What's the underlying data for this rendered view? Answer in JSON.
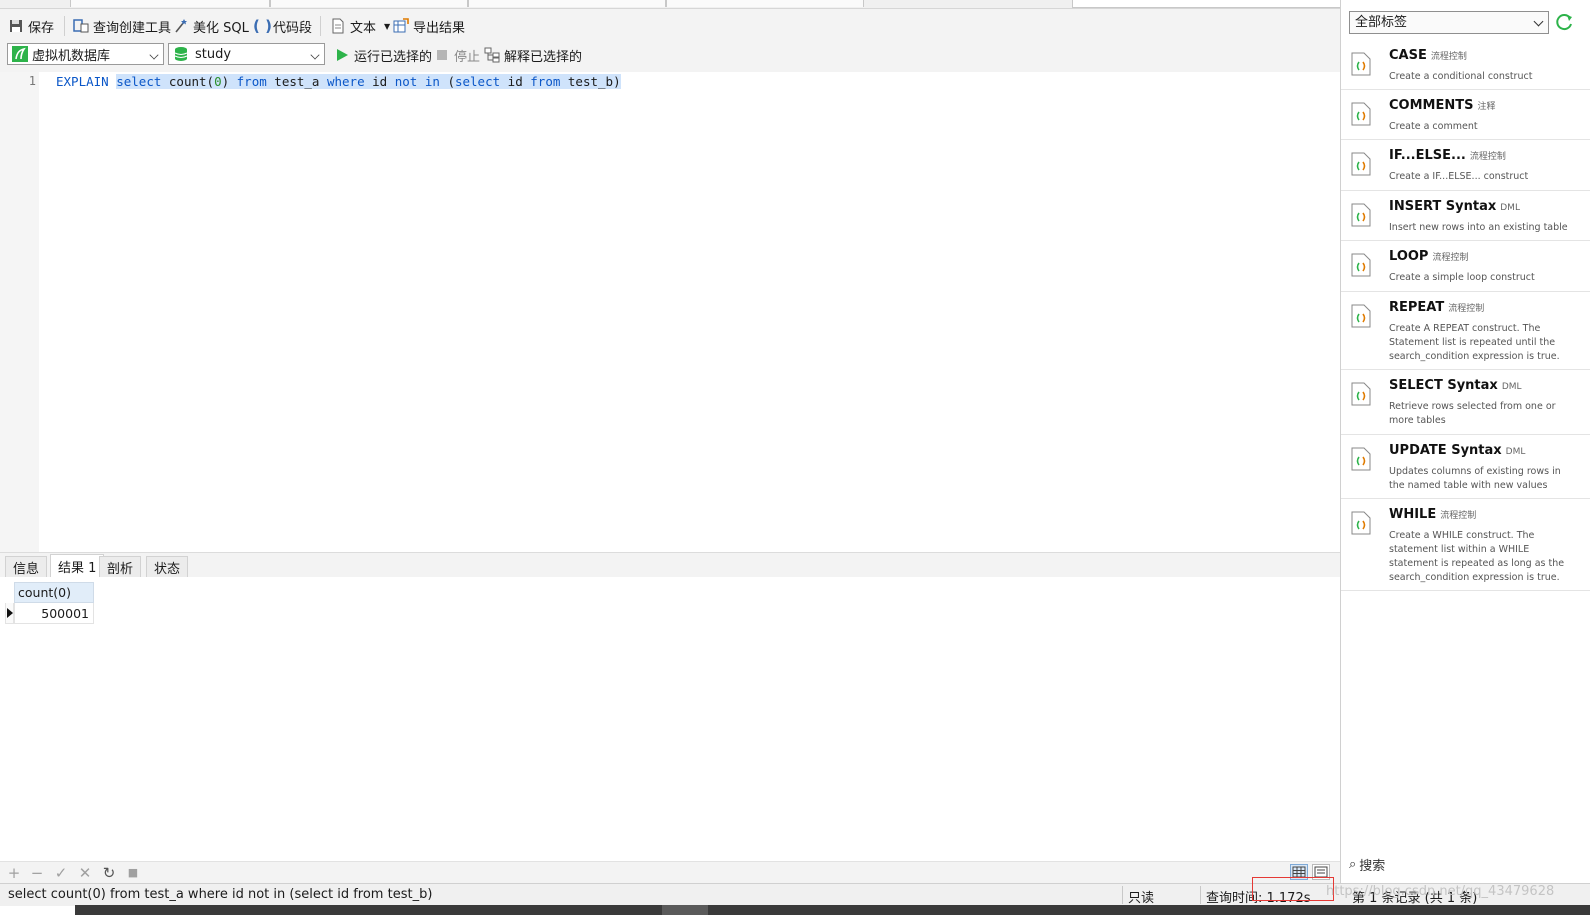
{
  "toolbar": {
    "save": "保存",
    "query_builder": "查询创建工具",
    "beautify_sql": "美化 SQL",
    "code_snippet": "代码段",
    "text": "文本",
    "export_result": "导出结果"
  },
  "toolbar2": {
    "connection": "虚拟机数据库",
    "database": "study",
    "run_selected": "运行已选择的",
    "stop": "停止",
    "explain_selected": "解释已选择的"
  },
  "editor": {
    "line_number": "1",
    "keyword_explain": "EXPLAIN",
    "keyword_select": "select",
    "fn_count": "count(",
    "fn_arg": "0",
    "fn_close": ")",
    "keyword_from": "from",
    "table_a": "test_a",
    "keyword_where": "where",
    "col_id": "id",
    "keyword_not": "not",
    "keyword_in": "in",
    "paren_open": "(",
    "keyword_select2": "select",
    "col_id2": "id",
    "keyword_from2": "from",
    "table_b": "test_b",
    "paren_close": ")"
  },
  "result_tabs": [
    {
      "label": "信息",
      "active": false
    },
    {
      "label": "结果 1",
      "active": true
    },
    {
      "label": "剖析",
      "active": false
    },
    {
      "label": "状态",
      "active": false
    }
  ],
  "grid": {
    "column": "count(0)",
    "value": "500001"
  },
  "gridbar": {
    "add": "+",
    "remove": "−",
    "apply": "✓",
    "discard": "✕",
    "refresh": "↻",
    "stop": "■"
  },
  "status": {
    "sql": "select count(0) from test_a where id not in (select id from test_b)",
    "readonly": "只读",
    "query_time": "查询时间: 1.172s",
    "record": "第 1 条记录 (共 1 条)",
    "watermark": "https://blog.csdn.net/qq_43479628"
  },
  "snippets_panel": {
    "filter": "全部标签",
    "search": "搜索",
    "items": [
      {
        "title": "CASE",
        "tag": "流程控制",
        "desc": "Create a conditional construct"
      },
      {
        "title": "COMMENTS",
        "tag": "注释",
        "desc": "Create a comment"
      },
      {
        "title": "IF...ELSE...",
        "tag": "流程控制",
        "desc": "Create a IF...ELSE... construct"
      },
      {
        "title": "INSERT Syntax",
        "tag": "DML",
        "desc": "Insert new rows into an existing table"
      },
      {
        "title": "LOOP",
        "tag": "流程控制",
        "desc": "Create a simple loop construct"
      },
      {
        "title": "REPEAT",
        "tag": "流程控制",
        "desc": "Create A REPEAT construct. The Statement list is repeated until the search_condition expression is true."
      },
      {
        "title": "SELECT Syntax",
        "tag": "DML",
        "desc": "Retrieve rows selected from one or more tables"
      },
      {
        "title": "UPDATE Syntax",
        "tag": "DML",
        "desc": "Updates columns of existing rows in the named table with new values"
      },
      {
        "title": "WHILE",
        "tag": "流程控制",
        "desc": "Create a WHILE construct. The statement list within a WHILE statement is repeated as long as the search_condition expression is true."
      }
    ]
  },
  "colors": {
    "keyword": "#0b57c8",
    "selection": "#cfe3fb",
    "header_cell": "#e1edf9",
    "highlight_box": "#e53935",
    "run_green": "#2db34a"
  }
}
